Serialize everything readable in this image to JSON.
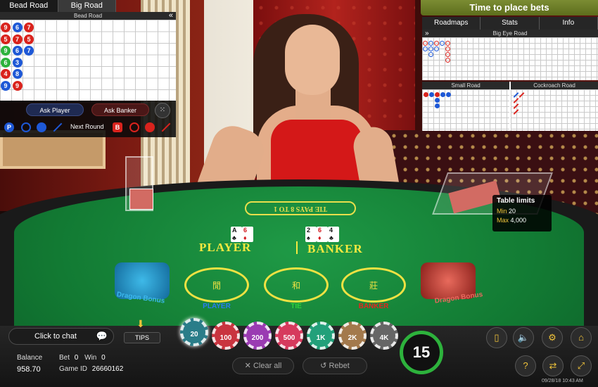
{
  "roads_left": {
    "tabs": [
      "Bead Road",
      "Big Road"
    ],
    "bead_road_title": "Bead Road",
    "collapse_icon": "«",
    "beads": [
      {
        "col": 0,
        "row": 0,
        "n": "9",
        "c": "red"
      },
      {
        "col": 0,
        "row": 1,
        "n": "5",
        "c": "red"
      },
      {
        "col": 0,
        "row": 2,
        "n": "9",
        "c": "green"
      },
      {
        "col": 0,
        "row": 3,
        "n": "6",
        "c": "green"
      },
      {
        "col": 0,
        "row": 4,
        "n": "4",
        "c": "red"
      },
      {
        "col": 0,
        "row": 5,
        "n": "9",
        "c": "blue"
      },
      {
        "col": 1,
        "row": 0,
        "n": "6",
        "c": "blue"
      },
      {
        "col": 1,
        "row": 1,
        "n": "7",
        "c": "red"
      },
      {
        "col": 1,
        "row": 2,
        "n": "6",
        "c": "blue"
      },
      {
        "col": 1,
        "row": 3,
        "n": "3",
        "c": "blue"
      },
      {
        "col": 1,
        "row": 4,
        "n": "8",
        "c": "blue"
      },
      {
        "col": 1,
        "row": 5,
        "n": "9",
        "c": "red"
      },
      {
        "col": 2,
        "row": 0,
        "n": "7",
        "c": "red"
      },
      {
        "col": 2,
        "row": 1,
        "n": "5",
        "c": "red"
      },
      {
        "col": 2,
        "row": 2,
        "n": "7",
        "c": "blue"
      }
    ]
  },
  "ask": {
    "player": "Ask Player",
    "banker": "Ask Banker",
    "next_round": "Next Round",
    "p_badge": "P",
    "b_badge": "B"
  },
  "status": "Time to place bets",
  "right_tabs": [
    "Roadmaps",
    "Stats",
    "Info"
  ],
  "big_eye_title": "Big Eye Road",
  "small_road_title": "Small Road",
  "cockroach_title": "Cockroach Road",
  "table_limits": {
    "title": "Table limits",
    "min_label": "Min",
    "min": "20",
    "max_label": "Max",
    "max": "4,000"
  },
  "table": {
    "pays_sign": "TIE PAYS 8 TO 1",
    "player_label": "PLAYER",
    "banker_label": "BANKER",
    "player_cards": [
      [
        "A",
        "♣",
        "black"
      ],
      [
        "6",
        "♦",
        "red"
      ]
    ],
    "banker_cards": [
      [
        "2",
        "♠",
        "black"
      ],
      [
        "6",
        "♦",
        "red"
      ],
      [
        "4",
        "♣",
        "black"
      ]
    ],
    "bets": [
      {
        "label": "PLAYER",
        "glyph": "閒",
        "color": "#2b7bf2"
      },
      {
        "label": "TIE",
        "glyph": "和",
        "color": "#2fd23a"
      },
      {
        "label": "BANKER",
        "glyph": "莊",
        "color": "#e8231f"
      }
    ],
    "dragon_left": "Dragon Bonus",
    "dragon_right": "Dragon Bonus"
  },
  "chat": {
    "label": "Click to chat"
  },
  "tips": {
    "label": "TIPS"
  },
  "chips": [
    {
      "value": "20",
      "color": "#2a7d89"
    },
    {
      "value": "100",
      "color": "#c9343f"
    },
    {
      "value": "200",
      "color": "#9a3bb2"
    },
    {
      "value": "500",
      "color": "#d63a5d"
    },
    {
      "value": "1K",
      "color": "#22a07a"
    },
    {
      "value": "2K",
      "color": "#a3794c"
    },
    {
      "value": "4K",
      "color": "#666666"
    }
  ],
  "timer": "15",
  "actions": {
    "clear": "Clear all",
    "rebet": "Rebet"
  },
  "account": {
    "balance_label": "Balance",
    "balance": "958.70",
    "bet_label": "Bet",
    "bet": "0",
    "win_label": "Win",
    "win": "0",
    "game_id_label": "Game ID",
    "game_id": "26660162"
  },
  "timestamp": "09/28/18  10:43 AM",
  "colors": {
    "player_blue": "#1e58d6",
    "banker_red": "#d9231d",
    "tie_green": "#2db23c",
    "felt": "#127a33"
  }
}
